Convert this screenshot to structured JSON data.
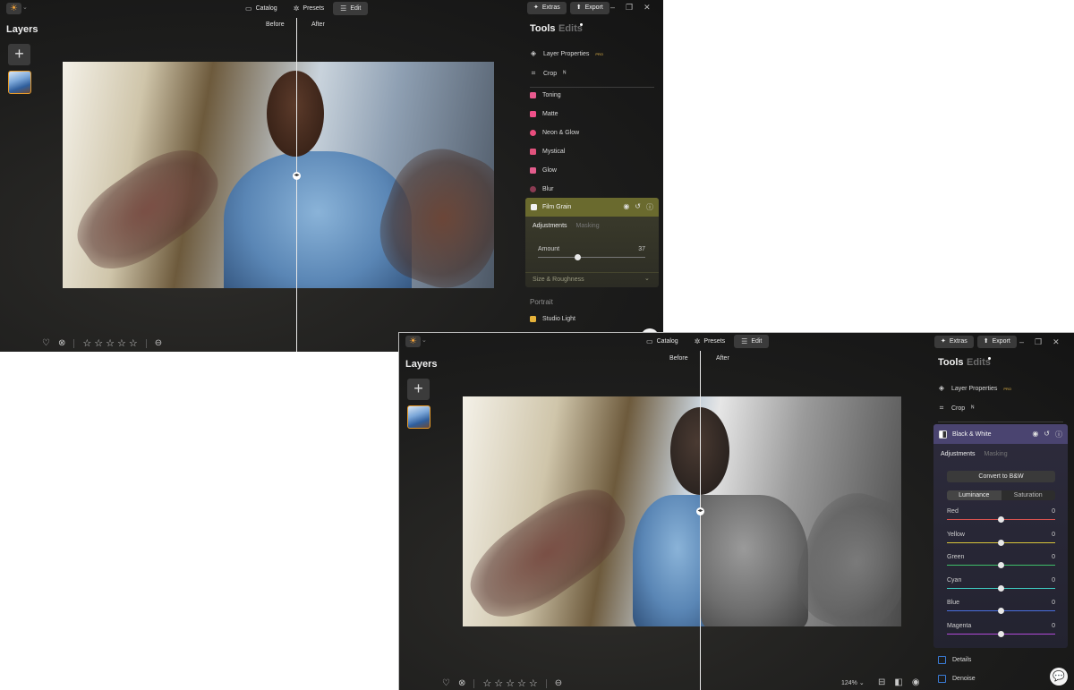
{
  "app": {
    "logo_glyph": "☀",
    "caret": "⌄",
    "modes": [
      {
        "label": "Catalog",
        "icon": "folder-icon",
        "glyph": "▭"
      },
      {
        "label": "Presets",
        "icon": "presets-icon",
        "glyph": "✲"
      },
      {
        "label": "Edit",
        "icon": "sliders-icon",
        "glyph": "☰"
      }
    ],
    "extras_label": "Extras",
    "extras_glyph": "✦",
    "export_label": "Export",
    "export_glyph": "⬆",
    "window_controls": [
      "–",
      "❐",
      "✕"
    ],
    "layers_title": "Layers",
    "add_glyph": "+",
    "before_label": "Before",
    "after_label": "After",
    "split_glyph": "◂▸",
    "tools_title": "Tools",
    "edits_title": "Edits",
    "pro_badge": "PRO",
    "bottom": {
      "heart": "♡",
      "reject": "⊗",
      "stars": [
        "☆",
        "☆",
        "☆",
        "☆",
        "☆"
      ],
      "minus": "⊖"
    }
  },
  "window1": {
    "tools": [
      {
        "label": "Layer Properties",
        "icon": "layers-icon",
        "glyph": "◈",
        "pro": true
      },
      {
        "label": "Crop",
        "icon": "crop-icon",
        "glyph": "⌗",
        "suffix": "ᴺ"
      }
    ],
    "creative_tools": [
      {
        "label": "Toning",
        "icon": "toning-icon",
        "color": "#e95a8f"
      },
      {
        "label": "Matte",
        "icon": "matte-icon",
        "color": "#f0508a"
      },
      {
        "label": "Neon & Glow",
        "icon": "neon-glow-icon",
        "color": "#e94d7d"
      },
      {
        "label": "Mystical",
        "icon": "mystical-icon",
        "color": "#e0527c"
      },
      {
        "label": "Glow",
        "icon": "glow-icon",
        "color": "#e35c8c"
      },
      {
        "label": "Blur",
        "icon": "blur-icon",
        "color": "#8a3b52"
      }
    ],
    "active_tool": {
      "label": "Film Grain",
      "tabs": [
        "Adjustments",
        "Masking"
      ],
      "slider": {
        "label": "Amount",
        "value": "37",
        "fraction": 0.37
      },
      "collapsed_section": "Size & Roughness",
      "chevron": "⌄",
      "header_color": "#6a6a2e"
    },
    "section_title": "Portrait",
    "portrait_tools": [
      {
        "label": "Studio Light",
        "icon": "studio-light-icon",
        "color": "#e6b23a"
      }
    ]
  },
  "window2": {
    "tools": [
      {
        "label": "Layer Properties",
        "icon": "layers-icon",
        "glyph": "◈",
        "pro": true
      },
      {
        "label": "Crop",
        "icon": "crop-icon",
        "glyph": "⌗",
        "suffix": "ᴺ"
      }
    ],
    "active_tool": {
      "label": "Black & White",
      "tabs": [
        "Adjustments",
        "Masking"
      ],
      "convert_label": "Convert to B&W",
      "segments": [
        "Luminance",
        "Saturation"
      ],
      "header_color": "#4a4470",
      "sliders": [
        {
          "label": "Red",
          "value": "0",
          "fraction": 0.5,
          "color": "#d9534f"
        },
        {
          "label": "Yellow",
          "value": "0",
          "fraction": 0.5,
          "color": "#d8c53a"
        },
        {
          "label": "Green",
          "value": "0",
          "fraction": 0.5,
          "color": "#3fbf6a"
        },
        {
          "label": "Cyan",
          "value": "0",
          "fraction": 0.5,
          "color": "#3ec9c0"
        },
        {
          "label": "Blue",
          "value": "0",
          "fraction": 0.5,
          "color": "#4a6fe0"
        },
        {
          "label": "Magenta",
          "value": "0",
          "fraction": 0.5,
          "color": "#b24ad8"
        }
      ]
    },
    "more_tools": [
      {
        "label": "Details",
        "icon": "details-checkbox"
      },
      {
        "label": "Denoise",
        "icon": "denoise-checkbox"
      }
    ],
    "zoom_label": "124%",
    "view_icons": [
      "⊟",
      "◧",
      "◉"
    ],
    "chat_glyph": "💬"
  }
}
